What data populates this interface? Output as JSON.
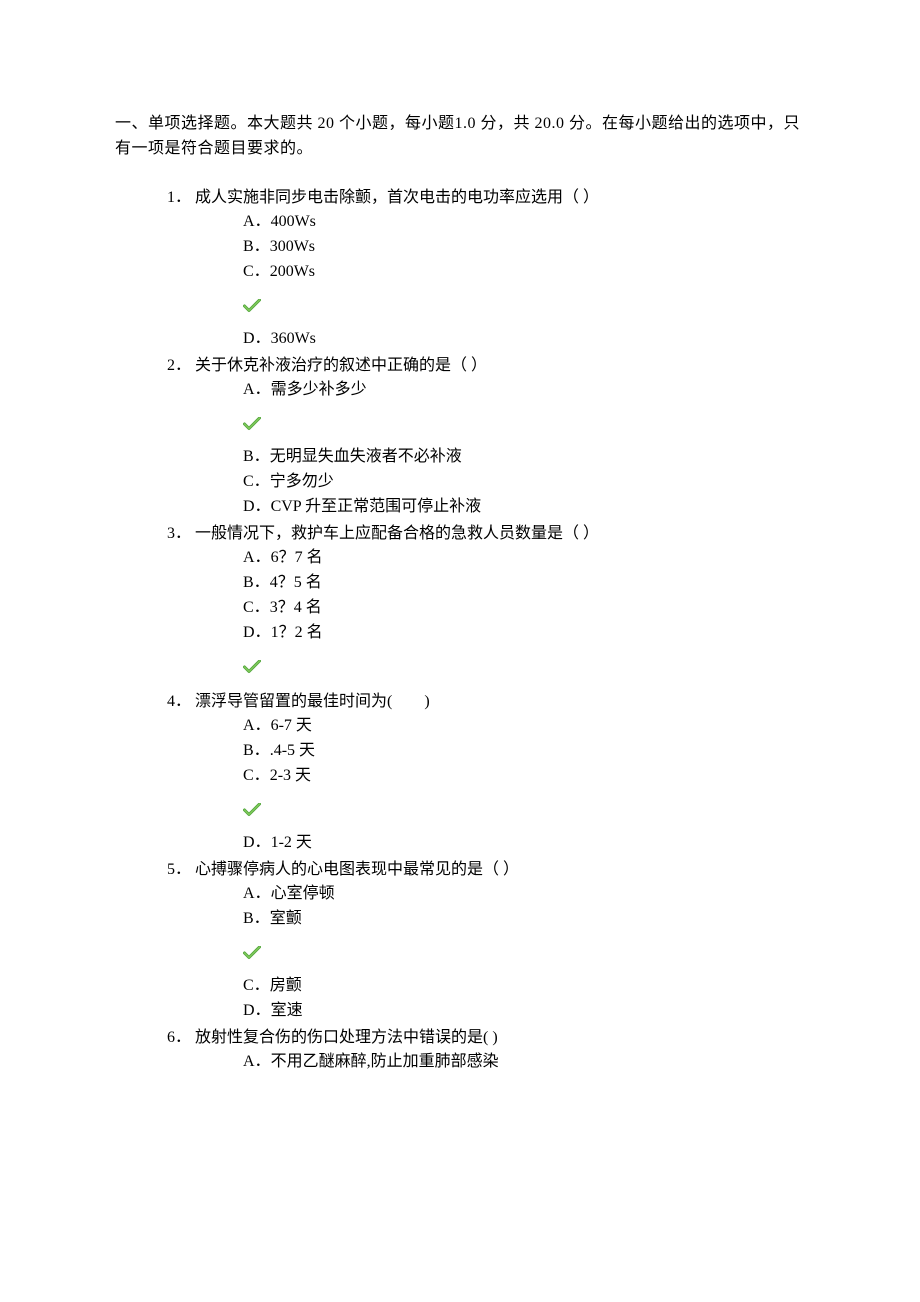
{
  "section_header": "一、单项选择题。本大题共 20 个小题，每小题1.0 分，共 20.0 分。在每小题给出的选项中，只有一项是符合题目要求的。",
  "questions": [
    {
      "num": "1．",
      "stem": "成人实施非同步电击除颤，首次电击的电功率应选用（ ）",
      "groups": [
        {
          "opts": [
            {
              "l": "A．",
              "t": "400Ws"
            },
            {
              "l": "B．",
              "t": "300Ws"
            },
            {
              "l": "C．",
              "t": "200Ws"
            }
          ],
          "check_after": true
        },
        {
          "opts": [
            {
              "l": "D．",
              "t": "360Ws"
            }
          ],
          "check_after": false
        }
      ]
    },
    {
      "num": "2．",
      "stem": "关于休克补液治疗的叙述中正确的是（ ）",
      "groups": [
        {
          "opts": [
            {
              "l": "A．",
              "t": "需多少补多少"
            }
          ],
          "check_after": true
        },
        {
          "opts": [
            {
              "l": "B．",
              "t": "无明显失血失液者不必补液"
            },
            {
              "l": "C．",
              "t": "宁多勿少"
            },
            {
              "l": "D．",
              "t": "CVP 升至正常范围可停止补液"
            }
          ],
          "check_after": false
        }
      ]
    },
    {
      "num": "3．",
      "stem": "一般情况下，救护车上应配备合格的急救人员数量是（ ）",
      "groups": [
        {
          "opts": [
            {
              "l": "A．",
              "t": "6？7 名"
            },
            {
              "l": "B．",
              "t": "4？5 名"
            },
            {
              "l": "C．",
              "t": "3？4 名"
            },
            {
              "l": "D．",
              "t": "1？2 名"
            }
          ],
          "check_after": true
        }
      ]
    },
    {
      "num": "4．",
      "stem": "漂浮导管留置的最佳时间为(　　)",
      "groups": [
        {
          "opts": [
            {
              "l": "A．",
              "t": "6-7 天"
            },
            {
              "l": "B．",
              "t": ".4-5 天"
            },
            {
              "l": "C．",
              "t": "2-3 天"
            }
          ],
          "check_after": true
        },
        {
          "opts": [
            {
              "l": "D．",
              "t": "1-2 天"
            }
          ],
          "check_after": false
        }
      ]
    },
    {
      "num": "5．",
      "stem": "心搏骤停病人的心电图表现中最常见的是（ ）",
      "groups": [
        {
          "opts": [
            {
              "l": "A．",
              "t": "心室停顿"
            },
            {
              "l": "B．",
              "t": "室颤"
            }
          ],
          "check_after": true
        },
        {
          "opts": [
            {
              "l": "C．",
              "t": "房颤"
            },
            {
              "l": "D．",
              "t": "室速"
            }
          ],
          "check_after": false
        }
      ]
    },
    {
      "num": "6．",
      "stem": "放射性复合伤的伤口处理方法中错误的是( )",
      "groups": [
        {
          "opts": [
            {
              "l": "A．",
              "t": "不用乙醚麻醉,防止加重肺部感染"
            }
          ],
          "check_after": false
        }
      ]
    }
  ]
}
